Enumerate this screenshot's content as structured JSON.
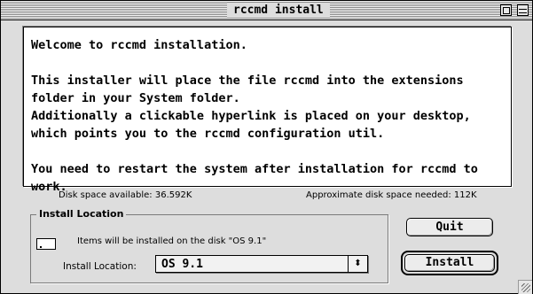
{
  "window": {
    "title": "rccmd install"
  },
  "message": {
    "line1": "Welcome to rccmd installation.",
    "line2": "This installer will place the file rccmd into the extensions folder in your System folder.",
    "line3": "Additionally a clickable hyperlink is placed on your desktop, which points you to the rccmd configuration util.",
    "line4": "You need to restart the system after installation for rccmd to work."
  },
  "disk": {
    "available": "Disk space available: 36.592K",
    "needed": "Approximate disk space needed: 112K"
  },
  "install_location": {
    "legend": "Install Location",
    "items_text": "Items will be installed on the disk \"OS 9.1\"",
    "label": "Install Location:",
    "selected": "OS 9.1",
    "popup_arrows": "⬍"
  },
  "buttons": {
    "quit": "Quit",
    "install": "Install"
  }
}
